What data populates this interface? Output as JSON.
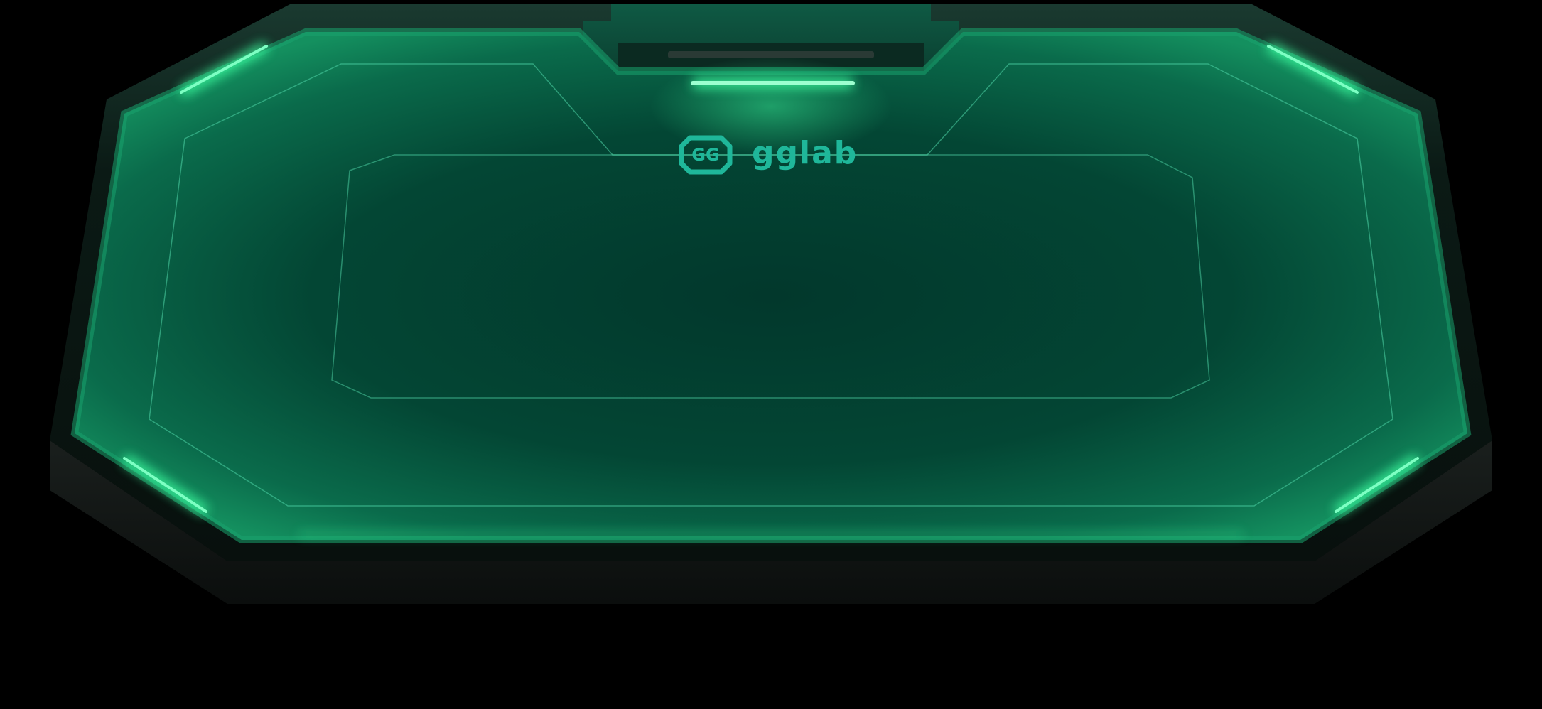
{
  "table": {
    "brand": {
      "name": "gglab",
      "logo_icon": "gg-octagon-logo-icon"
    },
    "colors": {
      "background": "#000000",
      "felt_center": "#02382c",
      "felt_edge": "#0f7a55",
      "rail_dark": "#0b1512",
      "rail_base": "#141a18",
      "neon_glow": "#3dffa0",
      "line": "#4fd6a8",
      "logo": "#1fb79a"
    }
  }
}
